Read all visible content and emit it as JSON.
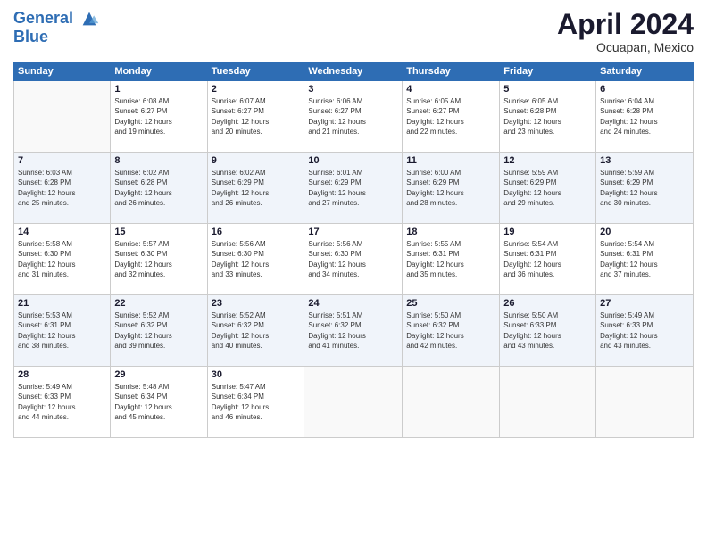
{
  "header": {
    "logo_line1": "General",
    "logo_line2": "Blue",
    "month": "April 2024",
    "location": "Ocuapan, Mexico"
  },
  "weekdays": [
    "Sunday",
    "Monday",
    "Tuesday",
    "Wednesday",
    "Thursday",
    "Friday",
    "Saturday"
  ],
  "weeks": [
    [
      {
        "day": "",
        "info": ""
      },
      {
        "day": "1",
        "info": "Sunrise: 6:08 AM\nSunset: 6:27 PM\nDaylight: 12 hours\nand 19 minutes."
      },
      {
        "day": "2",
        "info": "Sunrise: 6:07 AM\nSunset: 6:27 PM\nDaylight: 12 hours\nand 20 minutes."
      },
      {
        "day": "3",
        "info": "Sunrise: 6:06 AM\nSunset: 6:27 PM\nDaylight: 12 hours\nand 21 minutes."
      },
      {
        "day": "4",
        "info": "Sunrise: 6:05 AM\nSunset: 6:27 PM\nDaylight: 12 hours\nand 22 minutes."
      },
      {
        "day": "5",
        "info": "Sunrise: 6:05 AM\nSunset: 6:28 PM\nDaylight: 12 hours\nand 23 minutes."
      },
      {
        "day": "6",
        "info": "Sunrise: 6:04 AM\nSunset: 6:28 PM\nDaylight: 12 hours\nand 24 minutes."
      }
    ],
    [
      {
        "day": "7",
        "info": "Sunrise: 6:03 AM\nSunset: 6:28 PM\nDaylight: 12 hours\nand 25 minutes."
      },
      {
        "day": "8",
        "info": "Sunrise: 6:02 AM\nSunset: 6:28 PM\nDaylight: 12 hours\nand 26 minutes."
      },
      {
        "day": "9",
        "info": "Sunrise: 6:02 AM\nSunset: 6:29 PM\nDaylight: 12 hours\nand 26 minutes."
      },
      {
        "day": "10",
        "info": "Sunrise: 6:01 AM\nSunset: 6:29 PM\nDaylight: 12 hours\nand 27 minutes."
      },
      {
        "day": "11",
        "info": "Sunrise: 6:00 AM\nSunset: 6:29 PM\nDaylight: 12 hours\nand 28 minutes."
      },
      {
        "day": "12",
        "info": "Sunrise: 5:59 AM\nSunset: 6:29 PM\nDaylight: 12 hours\nand 29 minutes."
      },
      {
        "day": "13",
        "info": "Sunrise: 5:59 AM\nSunset: 6:29 PM\nDaylight: 12 hours\nand 30 minutes."
      }
    ],
    [
      {
        "day": "14",
        "info": "Sunrise: 5:58 AM\nSunset: 6:30 PM\nDaylight: 12 hours\nand 31 minutes."
      },
      {
        "day": "15",
        "info": "Sunrise: 5:57 AM\nSunset: 6:30 PM\nDaylight: 12 hours\nand 32 minutes."
      },
      {
        "day": "16",
        "info": "Sunrise: 5:56 AM\nSunset: 6:30 PM\nDaylight: 12 hours\nand 33 minutes."
      },
      {
        "day": "17",
        "info": "Sunrise: 5:56 AM\nSunset: 6:30 PM\nDaylight: 12 hours\nand 34 minutes."
      },
      {
        "day": "18",
        "info": "Sunrise: 5:55 AM\nSunset: 6:31 PM\nDaylight: 12 hours\nand 35 minutes."
      },
      {
        "day": "19",
        "info": "Sunrise: 5:54 AM\nSunset: 6:31 PM\nDaylight: 12 hours\nand 36 minutes."
      },
      {
        "day": "20",
        "info": "Sunrise: 5:54 AM\nSunset: 6:31 PM\nDaylight: 12 hours\nand 37 minutes."
      }
    ],
    [
      {
        "day": "21",
        "info": "Sunrise: 5:53 AM\nSunset: 6:31 PM\nDaylight: 12 hours\nand 38 minutes."
      },
      {
        "day": "22",
        "info": "Sunrise: 5:52 AM\nSunset: 6:32 PM\nDaylight: 12 hours\nand 39 minutes."
      },
      {
        "day": "23",
        "info": "Sunrise: 5:52 AM\nSunset: 6:32 PM\nDaylight: 12 hours\nand 40 minutes."
      },
      {
        "day": "24",
        "info": "Sunrise: 5:51 AM\nSunset: 6:32 PM\nDaylight: 12 hours\nand 41 minutes."
      },
      {
        "day": "25",
        "info": "Sunrise: 5:50 AM\nSunset: 6:32 PM\nDaylight: 12 hours\nand 42 minutes."
      },
      {
        "day": "26",
        "info": "Sunrise: 5:50 AM\nSunset: 6:33 PM\nDaylight: 12 hours\nand 43 minutes."
      },
      {
        "day": "27",
        "info": "Sunrise: 5:49 AM\nSunset: 6:33 PM\nDaylight: 12 hours\nand 43 minutes."
      }
    ],
    [
      {
        "day": "28",
        "info": "Sunrise: 5:49 AM\nSunset: 6:33 PM\nDaylight: 12 hours\nand 44 minutes."
      },
      {
        "day": "29",
        "info": "Sunrise: 5:48 AM\nSunset: 6:34 PM\nDaylight: 12 hours\nand 45 minutes."
      },
      {
        "day": "30",
        "info": "Sunrise: 5:47 AM\nSunset: 6:34 PM\nDaylight: 12 hours\nand 46 minutes."
      },
      {
        "day": "",
        "info": ""
      },
      {
        "day": "",
        "info": ""
      },
      {
        "day": "",
        "info": ""
      },
      {
        "day": "",
        "info": ""
      }
    ]
  ]
}
